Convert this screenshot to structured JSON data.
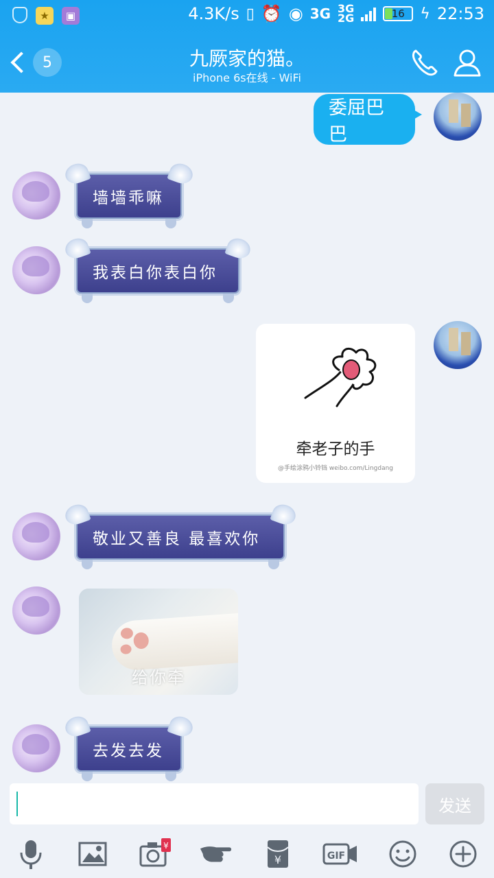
{
  "status_bar": {
    "net_speed": "4.3K/s",
    "signal_a": "3G",
    "signal_b_top": "3G",
    "signal_b_bottom": "2G",
    "battery": "16",
    "time": "22:53"
  },
  "header": {
    "back_badge": "5",
    "title": "九厥家的猫。",
    "subtitle": "iPhone 6s在线 - WiFi"
  },
  "messages": [
    {
      "side": "right",
      "type": "text",
      "text": "委屈巴巴"
    },
    {
      "side": "left",
      "type": "fancy",
      "text": "墙墙乖嘛"
    },
    {
      "side": "left",
      "type": "fancy",
      "text": "我表白你表白你"
    },
    {
      "side": "right",
      "type": "sticker",
      "caption": "牵老子的手",
      "small": "@手绘涂鸦小铃铛 weibo.com/Lingdang"
    },
    {
      "side": "left",
      "type": "fancy",
      "text": "敬业又善良 最喜欢你"
    },
    {
      "side": "left",
      "type": "image",
      "caption": "给你牵"
    },
    {
      "side": "left",
      "type": "fancy",
      "text": "去发去发"
    }
  ],
  "composer": {
    "send_label": "发送"
  },
  "toolbar": {
    "gif_label": "GIF",
    "red_packet_mark": "¥"
  }
}
